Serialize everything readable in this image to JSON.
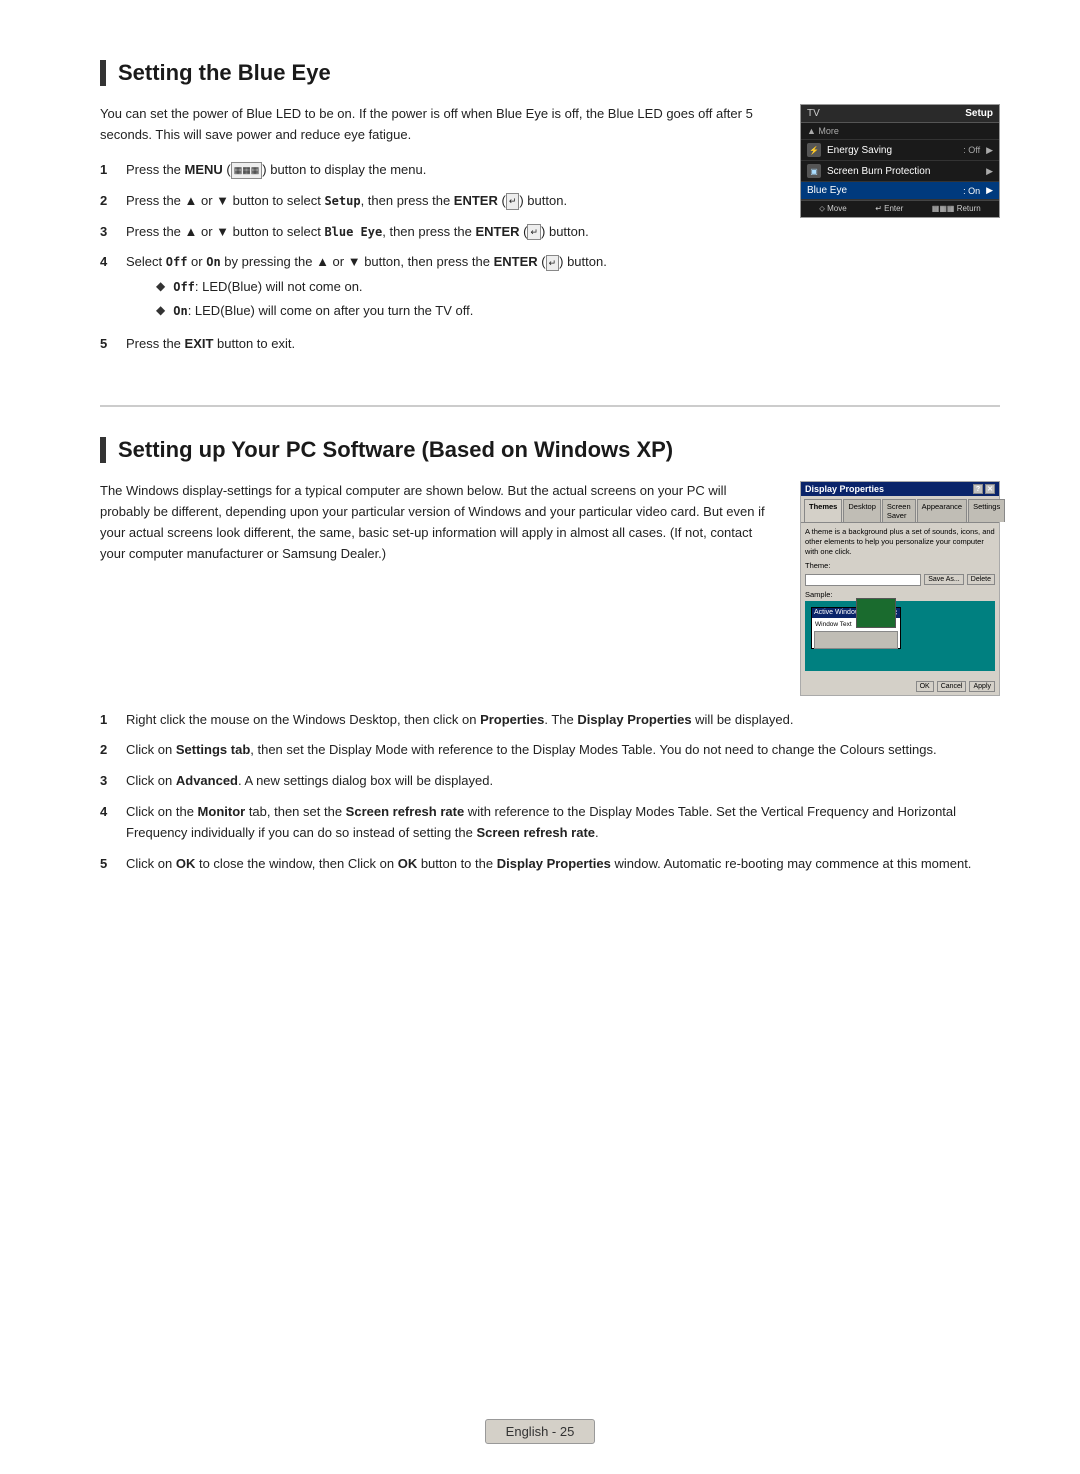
{
  "page": {
    "footer_label": "English - 25"
  },
  "section1": {
    "title": "Setting the Blue Eye",
    "intro": "You can set the power of Blue LED to be on. If the power is off when Blue Eye is off, the Blue LED goes off after 5 seconds. This will save power and reduce eye fatigue.",
    "steps": [
      {
        "num": "1",
        "text": "Press the MENU (▦▦▦) button to display the menu."
      },
      {
        "num": "2",
        "text": "Press the ▲ or ▼ button to select Setup, then press the ENTER (↵) button."
      },
      {
        "num": "3",
        "text": "Press the ▲ or ▼ button to select Blue Eye, then press the ENTER (↵) button."
      },
      {
        "num": "4",
        "text": "Select Off or On by pressing the ▲ or ▼ button, then press the ENTER (↵) button."
      },
      {
        "num": "5",
        "text": "Press the EXIT button to exit."
      }
    ],
    "bullets": [
      "Off: LED(Blue) will not come on.",
      "On: LED(Blue) will come on after you turn the TV off."
    ],
    "tv_menu": {
      "header_tv": "TV",
      "header_setup": "Setup",
      "rows": [
        {
          "icon": "▲",
          "label": "More",
          "value": "",
          "arrow": "",
          "more": true
        },
        {
          "icon": "⚡",
          "label": "Energy Saving",
          "value": ": Off",
          "arrow": "▶"
        },
        {
          "icon": "🖥",
          "label": "Screen Burn Protection",
          "value": "",
          "arrow": "▶",
          "highlighted": false
        },
        {
          "icon": "",
          "label": "Blue Eye",
          "value": ": On",
          "arrow": "▶",
          "highlighted": true
        }
      ],
      "footer": [
        "⬦ Move",
        "↵ Enter",
        "▦▦▦ Return"
      ]
    }
  },
  "section2": {
    "title": "Setting up Your PC Software (Based on Windows XP)",
    "intro": "The Windows display-settings for a typical computer are shown below. But the actual screens on your PC will probably be different, depending upon your particular version of Windows and your particular video card. But even if your actual screens look different, the same, basic set-up information will apply in almost all cases. (If not, contact your computer manufacturer or Samsung Dealer.)",
    "steps": [
      {
        "num": "1",
        "text": "Right click the mouse on the Windows Desktop, then click on Properties. The Display Properties will be displayed."
      },
      {
        "num": "2",
        "text": "Click on Settings tab, then set the Display Mode with reference to the Display Modes Table. You do not need to change the Colours settings."
      },
      {
        "num": "3",
        "text": "Click on Advanced. A new settings dialog box will be displayed."
      },
      {
        "num": "4",
        "text": "Click on the Monitor tab, then set the Screen refresh rate with reference to the Display Modes Table. Set the Vertical Frequency and Horizontal Frequency individually if you can do so instead of setting the Screen refresh rate."
      },
      {
        "num": "5",
        "text": "Click on OK to close the window, then Click on OK button to the Display Properties window. Automatic re-booting may commence at this moment."
      }
    ],
    "display_props": {
      "title": "Display Properties",
      "tabs": [
        "Themes",
        "Desktop",
        "Screen Saver",
        "Appearance",
        "Settings"
      ],
      "active_tab": "Themes",
      "description": "A theme is a background plus a set of sounds, icons, and other elements to help you personalize your computer with one click.",
      "theme_label": "Theme:",
      "save_as_btn": "Save As...",
      "delete_btn": "Delete",
      "sample_label": "Sample:",
      "active_window_title": "Active Window",
      "window_text": "Window Text",
      "ok_btn": "OK",
      "cancel_btn": "Cancel",
      "apply_btn": "Apply"
    }
  }
}
